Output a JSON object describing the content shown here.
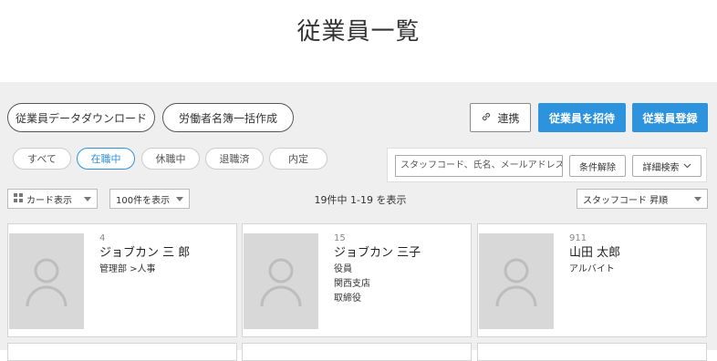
{
  "page_title": "従業員一覧",
  "toolbar": {
    "download_label": "従業員データダウンロード",
    "roster_label": "労働者名簿一括作成",
    "link_label": "連携",
    "invite_label": "従業員を招待",
    "register_label": "従業員登録"
  },
  "status_tabs": [
    {
      "label": "すべて",
      "active": false
    },
    {
      "label": "在職中",
      "active": true
    },
    {
      "label": "休職中",
      "active": false
    },
    {
      "label": "退職済",
      "active": false
    },
    {
      "label": "内定",
      "active": false
    }
  ],
  "search": {
    "placeholder": "スタッフコード、氏名、メールアドレス",
    "clear_label": "条件解除",
    "advanced_label": "詳細検索"
  },
  "view": {
    "display_mode": "カード表示",
    "per_page": "100件を表示",
    "result_count": "19件中 1-19 を表示",
    "sort": "スタッフコード 昇順"
  },
  "employees": [
    {
      "code": "4",
      "name": "ジョブカン 三 郎",
      "lines": [
        "管理部 >人事"
      ]
    },
    {
      "code": "15",
      "name": "ジョブカン 三子",
      "lines": [
        "役員",
        "関西支店",
        "取締役"
      ]
    },
    {
      "code": "911",
      "name": "山田 太郎",
      "lines": [
        "アルバイト"
      ]
    }
  ],
  "colors": {
    "accent": "#2e93dd",
    "background": "#efefef"
  }
}
